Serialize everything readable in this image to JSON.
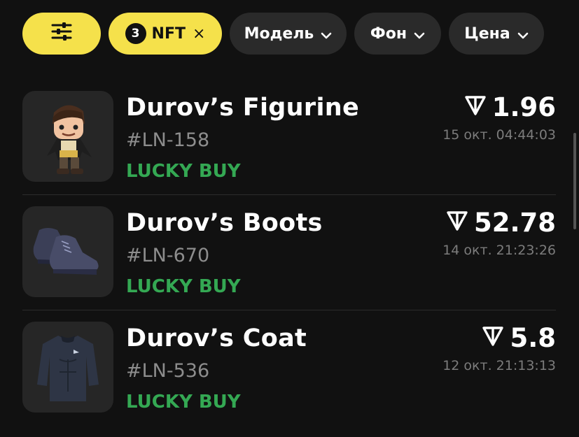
{
  "filters": {
    "settings_icon": "sliders-icon",
    "nft_count": "3",
    "nft_label": "NFT",
    "clear_symbol": "×",
    "model_label": "Модель",
    "background_label": "Фон",
    "price_label": "Цена"
  },
  "items": [
    {
      "name": "Durov’s Figurine",
      "number": "#LN-158",
      "tag": "LUCKY BUY",
      "price": "1.96",
      "date": "15 окт. 04:44:03",
      "image": "figurine"
    },
    {
      "name": "Durov’s Boots",
      "number": "#LN-670",
      "tag": "LUCKY BUY",
      "price": "52.78",
      "date": "14 окт. 21:23:26",
      "image": "boots"
    },
    {
      "name": "Durov’s Coat",
      "number": "#LN-536",
      "tag": "LUCKY BUY",
      "price": "5.8",
      "date": "12 окт. 21:13:13",
      "image": "coat"
    }
  ],
  "colors": {
    "accent": "#f5e14b",
    "tag_green": "#34a853",
    "chip_dark": "#2a2a2a",
    "background": "#111111"
  }
}
